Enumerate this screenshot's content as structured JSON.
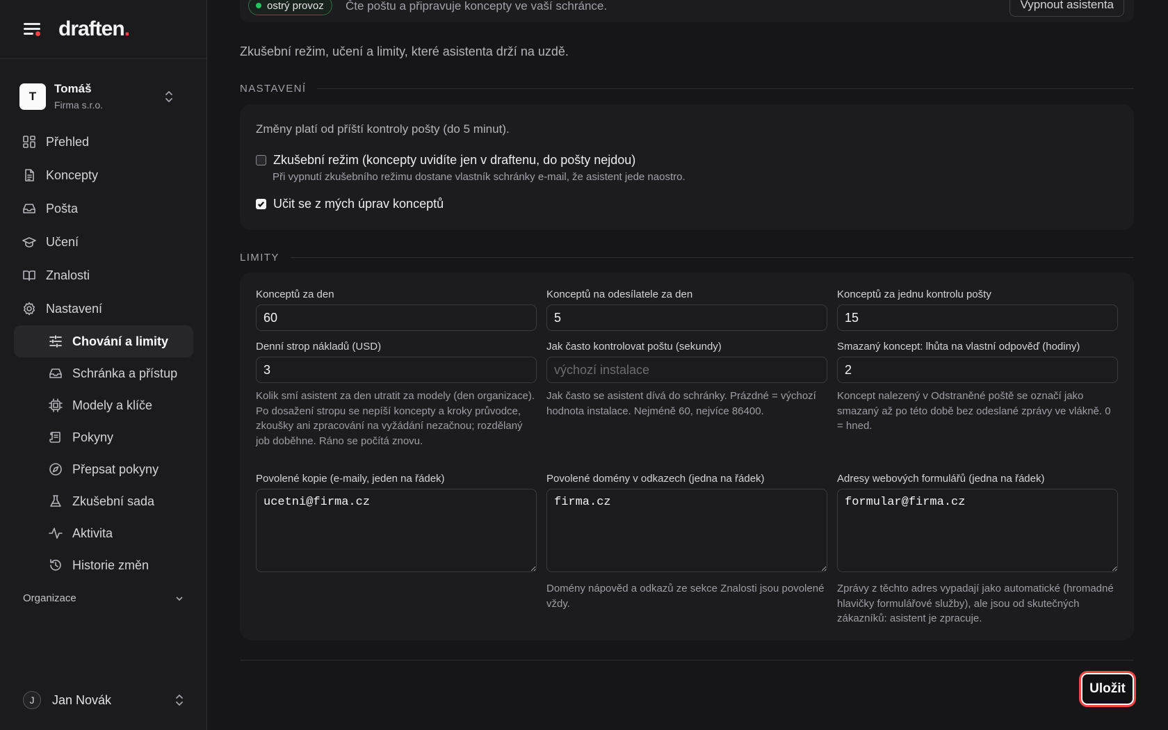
{
  "brand": {
    "logo_text": "draften",
    "logo_dot": "."
  },
  "org": {
    "initial": "T",
    "name": "Tomáš",
    "company": "Firma s.r.o."
  },
  "nav": {
    "items": [
      {
        "label": "Přehled",
        "icon": "dashboard-icon"
      },
      {
        "label": "Koncepty",
        "icon": "document-icon"
      },
      {
        "label": "Pošta",
        "icon": "inbox-icon"
      },
      {
        "label": "Učení",
        "icon": "graduation-cap-icon"
      },
      {
        "label": "Znalosti",
        "icon": "book-icon"
      },
      {
        "label": "Nastavení",
        "icon": "gear-icon"
      }
    ],
    "sub_items": [
      {
        "label": "Chování a limity",
        "icon": "sliders-icon",
        "active": true
      },
      {
        "label": "Schránka a přístup",
        "icon": "inbox-icon"
      },
      {
        "label": "Modely a klíče",
        "icon": "chip-icon"
      },
      {
        "label": "Pokyny",
        "icon": "scroll-icon"
      },
      {
        "label": "Přepsat pokyny",
        "icon": "compass-icon"
      },
      {
        "label": "Zkušební sada",
        "icon": "flask-icon"
      },
      {
        "label": "Aktivita",
        "icon": "activity-icon"
      },
      {
        "label": "Historie změn",
        "icon": "history-icon"
      }
    ],
    "section_org": "Organizace"
  },
  "user": {
    "initial": "J",
    "name": "Jan Novák"
  },
  "status": {
    "badge": "ostrý provoz",
    "text": "Čte poštu a připravuje koncepty ve vaší schránce.",
    "disable_button": "Vypnout asistenta"
  },
  "intro": "Zkušební režim, učení a limity, které asistenta drží na uzdě.",
  "settings": {
    "heading": "NASTAVENÍ",
    "note": "Změny platí od příští kontroly pošty (do 5 minut).",
    "trial_mode": {
      "label": "Zkušební režim (koncepty uvidíte jen v draftenu, do pošty nejdou)",
      "hint": "Při vypnutí zkušebního režimu dostane vlastník schránky e-mail, že asistent jede naostro.",
      "checked": false
    },
    "learn": {
      "label": "Učit se z mých úprav konceptů",
      "checked": true
    }
  },
  "limits": {
    "heading": "LIMITY",
    "drafts_per_day": {
      "label": "Konceptů za den",
      "value": "60"
    },
    "drafts_per_sender": {
      "label": "Konceptů na odesílatele za den",
      "value": "5"
    },
    "drafts_per_check": {
      "label": "Konceptů za jednu kontrolu pošty",
      "value": "15"
    },
    "cost_cap": {
      "label": "Denní strop nákladů (USD)",
      "value": "3",
      "help": "Kolik smí asistent za den utratit za modely (den organizace). Po dosažení stropu se nepíší koncepty a kroky průvodce, zkoušky ani zpracování na vyžádání nezačnou; rozdělaný job doběhne. Ráno se počítá znovu."
    },
    "check_interval": {
      "label": "Jak často kontrolovat poštu (sekundy)",
      "value": "",
      "placeholder": "výchozí instalace",
      "help": "Jak často se asistent dívá do schránky. Prázdné = výchozí hodnota instalace. Nejméně 60, nejvíce 86400."
    },
    "deleted_grace": {
      "label": "Smazaný koncept: lhůta na vlastní odpověď (hodiny)",
      "value": "2",
      "help": "Koncept nalezený v Odstraněné poště se označí jako smazaný až po této době bez odeslané zprávy ve vlákně. 0 = hned."
    },
    "allowed_cc": {
      "label": "Povolené kopie (e-maily, jeden na řádek)",
      "value": "ucetni@firma.cz"
    },
    "allowed_domains": {
      "label": "Povolené domény v odkazech (jedna na řádek)",
      "value": "firma.cz",
      "help": "Domény nápověd a odkazů ze sekce Znalosti jsou povolené vždy."
    },
    "form_addresses": {
      "label": "Adresy webových formulářů (jedna na řádek)",
      "value": "formular@firma.cz",
      "help": "Zprávy z těchto adres vypadají jako automatické (hromadné hlavičky formulářové služby), ale jsou od skutečných zákazníků: asistent je zpracuje."
    }
  },
  "save_button": "Uložit",
  "colors": {
    "accent": "#ef4444",
    "live": "#22c55e",
    "background": "#161618"
  }
}
